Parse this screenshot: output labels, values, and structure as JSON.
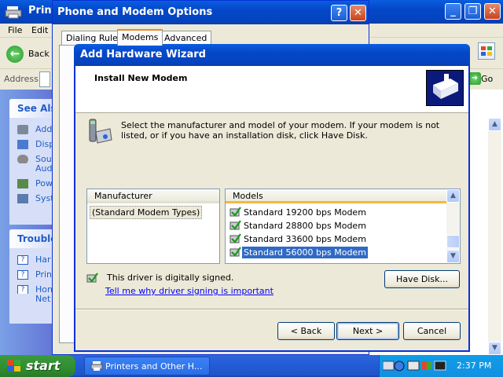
{
  "explorer": {
    "title": "Printer",
    "menu": [
      "File",
      "Edit"
    ],
    "back_label": "Back",
    "address_label": "Address",
    "go_label": "Go",
    "see_also": {
      "title": "See Als",
      "items": [
        "Add",
        "Disp",
        "Sou",
        "Powe",
        "Syst"
      ],
      "item_wrap": "Aud"
    },
    "troubleshoot": {
      "title": "Trouble",
      "items": [
        "Har",
        "Prin",
        "Hon"
      ],
      "item_wrap": "Net"
    }
  },
  "phone_modem": {
    "title": "Phone and Modem Options",
    "tabs": [
      "Dialing Rules",
      "Modems",
      "Advanced"
    ],
    "active_tab": "Modems"
  },
  "wizard": {
    "title": "Add Hardware Wizard",
    "heading": "Install New Modem",
    "instructions": "Select the manufacturer and model of your modem. If your modem is not listed, or if you have an installation disk, click Have Disk.",
    "manufacturer_header": "Manufacturer",
    "manufacturers": [
      "(Standard Modem Types)"
    ],
    "models_header": "Models",
    "models": [
      "Standard 19200 bps Modem",
      "Standard 28800 bps Modem",
      "Standard 33600 bps Modem",
      "Standard 56000 bps Modem"
    ],
    "selected_model": "Standard 56000 bps Modem",
    "signed_text": "This driver is digitally signed.",
    "signed_link": "Tell me why driver signing is important",
    "have_disk": "Have Disk...",
    "back": "< Back",
    "next": "Next >",
    "cancel": "Cancel"
  },
  "taskbar": {
    "start": "start",
    "app": "Printers and Other H...",
    "clock": "2:37 PM"
  }
}
